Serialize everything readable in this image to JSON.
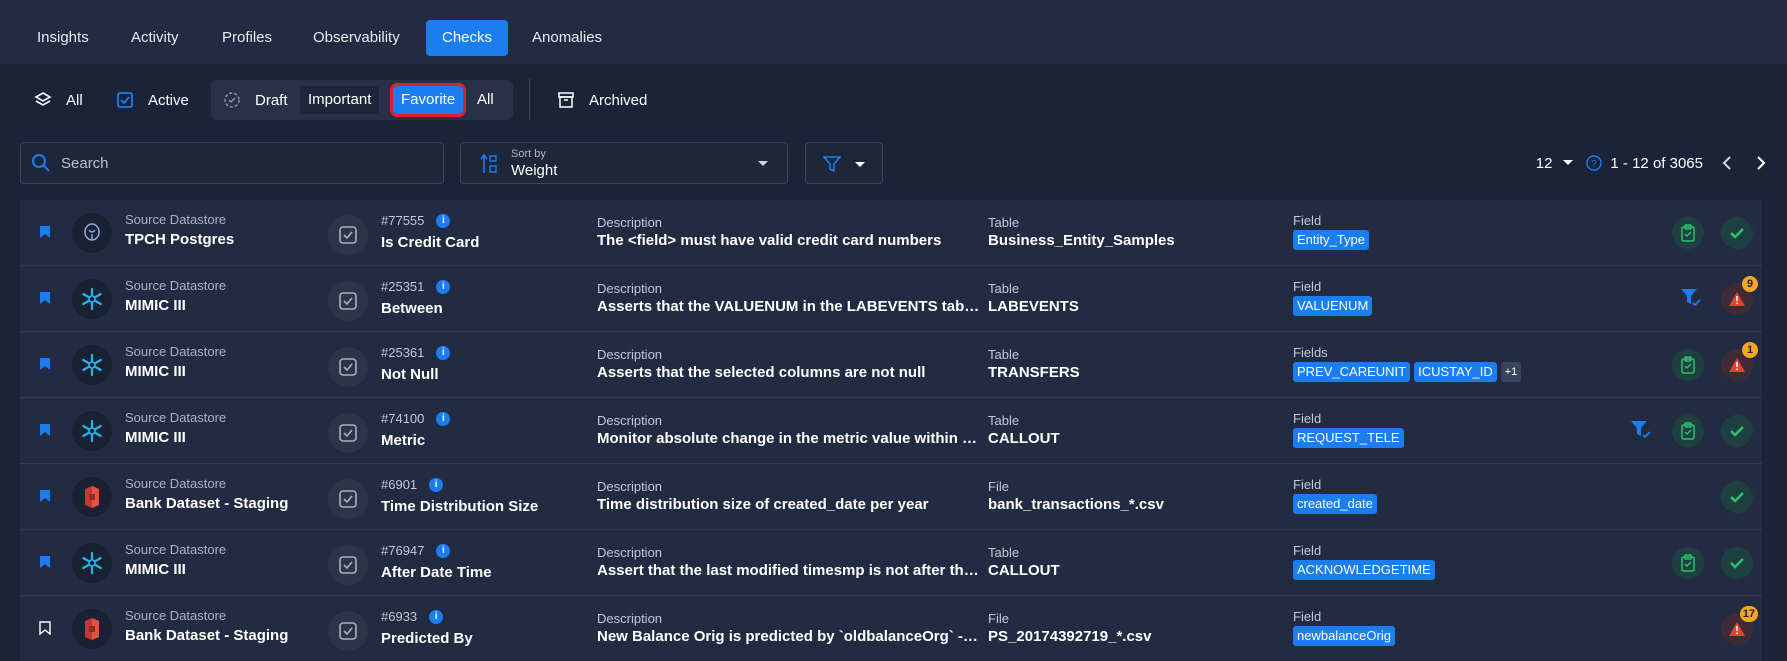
{
  "tabs": [
    "Insights",
    "Activity",
    "Profiles",
    "Observability",
    "Checks",
    "Anomalies"
  ],
  "active_tab": "Checks",
  "filters": {
    "all_label": "All",
    "active_label": "Active",
    "draft_label": "Draft",
    "important_label": "Important",
    "favorite_label": "Favorite",
    "all2_label": "All",
    "archived_label": "Archived"
  },
  "search": {
    "placeholder": "Search"
  },
  "sort": {
    "label": "Sort by",
    "value": "Weight"
  },
  "pager": {
    "per_page": "12",
    "range": "1 - 12 of 3065"
  },
  "colors": {
    "accent": "#1a7ef0",
    "highlight": "#e01d2d",
    "success": "#2fbf71",
    "danger": "#e8402c",
    "badge": "#f5a623"
  },
  "rows": [
    {
      "ds_label": "Source Datastore",
      "ds_name": "TPCH Postgres",
      "ds_icon": "postgres-icon",
      "id": "#77555",
      "name": "Is Credit Card",
      "desc_label": "Description",
      "desc": "The <field> must have valid credit card numbers",
      "tbl_label": "Table",
      "tbl": "Business_Entity_Samples",
      "field_label": "Field",
      "fields": [
        "Entity_Type"
      ],
      "more": "",
      "bookmarked": true,
      "filter_icon": false,
      "clipboard": true,
      "status": "passed",
      "badge": ""
    },
    {
      "ds_label": "Source Datastore",
      "ds_name": "MIMIC III",
      "ds_icon": "snowflake-icon",
      "id": "#25351",
      "name": "Between",
      "desc_label": "Description",
      "desc": "Asserts that the VALUENUM in the LABEVENTS table for...",
      "tbl_label": "Table",
      "tbl": "LABEVENTS",
      "field_label": "Field",
      "fields": [
        "VALUENUM"
      ],
      "more": "",
      "bookmarked": true,
      "filter_icon": true,
      "clipboard": false,
      "status": "anomaly",
      "badge": "9"
    },
    {
      "ds_label": "Source Datastore",
      "ds_name": "MIMIC III",
      "ds_icon": "snowflake-icon",
      "id": "#25361",
      "name": "Not Null",
      "desc_label": "Description",
      "desc": "Asserts that the selected columns are not null",
      "tbl_label": "Table",
      "tbl": "TRANSFERS",
      "field_label": "Fields",
      "fields": [
        "PREV_CAREUNIT",
        "ICUSTAY_ID"
      ],
      "more": "+1",
      "bookmarked": true,
      "filter_icon": false,
      "clipboard": true,
      "status": "anomaly",
      "badge": "1"
    },
    {
      "ds_label": "Source Datastore",
      "ds_name": "MIMIC III",
      "ds_icon": "snowflake-icon",
      "id": "#74100",
      "name": "Metric",
      "desc_label": "Description",
      "desc": "Monitor absolute change in the metric value within the ...",
      "tbl_label": "Table",
      "tbl": "CALLOUT",
      "field_label": "Field",
      "fields": [
        "REQUEST_TELE"
      ],
      "more": "",
      "bookmarked": true,
      "filter_icon": true,
      "clipboard": true,
      "status": "passed",
      "badge": ""
    },
    {
      "ds_label": "Source Datastore",
      "ds_name": "Bank Dataset - Staging",
      "ds_icon": "aws-s3-icon",
      "id": "#6901",
      "name": "Time Distribution Size",
      "desc_label": "Description",
      "desc": "Time distribution size of created_date per year",
      "tbl_label": "File",
      "tbl": "bank_transactions_*.csv",
      "field_label": "Field",
      "fields": [
        "created_date"
      ],
      "more": "",
      "bookmarked": true,
      "filter_icon": false,
      "clipboard": false,
      "status": "passed",
      "badge": ""
    },
    {
      "ds_label": "Source Datastore",
      "ds_name": "MIMIC III",
      "ds_icon": "snowflake-icon",
      "id": "#76947",
      "name": "After Date Time",
      "desc_label": "Description",
      "desc": "Assert that the last modified timesmp is not after the d...",
      "tbl_label": "Table",
      "tbl": "CALLOUT",
      "field_label": "Field",
      "fields": [
        "ACKNOWLEDGETIME"
      ],
      "more": "",
      "bookmarked": true,
      "filter_icon": false,
      "clipboard": true,
      "status": "passed",
      "badge": ""
    },
    {
      "ds_label": "Source Datastore",
      "ds_name": "Bank Dataset - Staging",
      "ds_icon": "aws-s3-icon",
      "id": "#6933",
      "name": "Predicted By",
      "desc_label": "Description",
      "desc": "New Balance Orig is predicted by `oldbalanceOrg` - `a...",
      "tbl_label": "File",
      "tbl": "PS_20174392719_*.csv",
      "field_label": "Field",
      "fields": [
        "newbalanceOrig"
      ],
      "more": "",
      "bookmarked": false,
      "filter_icon": false,
      "clipboard": false,
      "status": "anomaly",
      "badge": "17"
    }
  ]
}
